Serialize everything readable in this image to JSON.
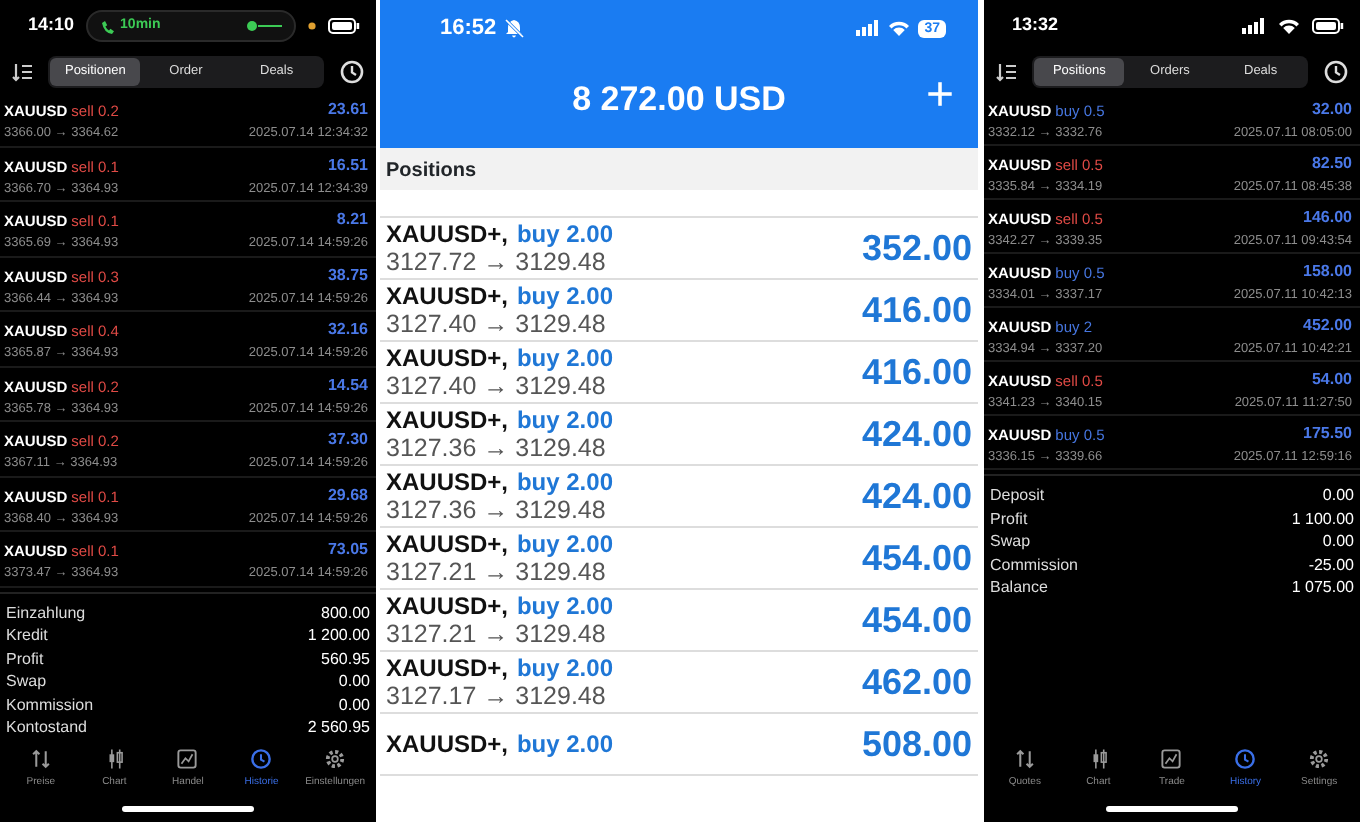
{
  "left_phone": {
    "status_bar": {
      "time": "14:10",
      "call_pill": "10min"
    },
    "segments": [
      {
        "label": "Positionen",
        "selected": true
      },
      {
        "label": "Order",
        "selected": false
      },
      {
        "label": "Deals",
        "selected": false
      }
    ],
    "positions": [
      {
        "symbol": "XAUUSD",
        "kind": "sell",
        "direction": "sell 0.2",
        "prices": "3366.00 → 3364.62",
        "time": "2025.07.14 12:34:32",
        "profit": "23.61"
      },
      {
        "symbol": "XAUUSD",
        "kind": "sell",
        "direction": "sell 0.1",
        "prices": "3366.70 → 3364.93",
        "time": "2025.07.14 12:34:39",
        "profit": "16.51"
      },
      {
        "symbol": "XAUUSD",
        "kind": "sell",
        "direction": "sell 0.1",
        "prices": "3365.69 → 3364.93",
        "time": "2025.07.14 14:59:26",
        "profit": "8.21"
      },
      {
        "symbol": "XAUUSD",
        "kind": "sell",
        "direction": "sell 0.3",
        "prices": "3366.44 → 3364.93",
        "time": "2025.07.14 14:59:26",
        "profit": "38.75"
      },
      {
        "symbol": "XAUUSD",
        "kind": "sell",
        "direction": "sell 0.4",
        "prices": "3365.87 → 3364.93",
        "time": "2025.07.14 14:59:26",
        "profit": "32.16"
      },
      {
        "symbol": "XAUUSD",
        "kind": "sell",
        "direction": "sell 0.2",
        "prices": "3365.78 → 3364.93",
        "time": "2025.07.14 14:59:26",
        "profit": "14.54"
      },
      {
        "symbol": "XAUUSD",
        "kind": "sell",
        "direction": "sell 0.2",
        "prices": "3367.11 → 3364.93",
        "time": "2025.07.14 14:59:26",
        "profit": "37.30"
      },
      {
        "symbol": "XAUUSD",
        "kind": "sell",
        "direction": "sell 0.1",
        "prices": "3368.40 → 3364.93",
        "time": "2025.07.14 14:59:26",
        "profit": "29.68"
      },
      {
        "symbol": "XAUUSD",
        "kind": "sell",
        "direction": "sell 0.1",
        "prices": "3373.47 → 3364.93",
        "time": "2025.07.14 14:59:26",
        "profit": "73.05"
      }
    ],
    "summary": [
      {
        "label": "Einzahlung",
        "value": "800.00"
      },
      {
        "label": "Kredit",
        "value": "1 200.00"
      },
      {
        "label": "Profit",
        "value": "560.95"
      },
      {
        "label": "Swap",
        "value": "0.00"
      },
      {
        "label": "Kommission",
        "value": "0.00"
      },
      {
        "label": "Kontostand",
        "value": "2 560.95"
      }
    ],
    "tab_bar": [
      {
        "label": "Preise",
        "selected": false
      },
      {
        "label": "Chart",
        "selected": false
      },
      {
        "label": "Handel",
        "selected": false
      },
      {
        "label": "Historie",
        "selected": true
      },
      {
        "label": "Einstellungen",
        "selected": false
      }
    ]
  },
  "middle_phone": {
    "status_bar": {
      "time": "16:52",
      "battery": "37"
    },
    "title": "8 272.00 USD",
    "add_button": "+",
    "section": "Positions",
    "positions": [
      {
        "symbol": "XAUUSD+,",
        "direction": "buy 2.00",
        "prices": "3127.72 → 3129.48",
        "profit": "352.00"
      },
      {
        "symbol": "XAUUSD+,",
        "direction": "buy 2.00",
        "prices": "3127.40 → 3129.48",
        "profit": "416.00"
      },
      {
        "symbol": "XAUUSD+,",
        "direction": "buy 2.00",
        "prices": "3127.40 → 3129.48",
        "profit": "416.00"
      },
      {
        "symbol": "XAUUSD+,",
        "direction": "buy 2.00",
        "prices": "3127.36 → 3129.48",
        "profit": "424.00"
      },
      {
        "symbol": "XAUUSD+,",
        "direction": "buy 2.00",
        "prices": "3127.36 → 3129.48",
        "profit": "424.00"
      },
      {
        "symbol": "XAUUSD+,",
        "direction": "buy 2.00",
        "prices": "3127.21 → 3129.48",
        "profit": "454.00"
      },
      {
        "symbol": "XAUUSD+,",
        "direction": "buy 2.00",
        "prices": "3127.21 → 3129.48",
        "profit": "454.00"
      },
      {
        "symbol": "XAUUSD+,",
        "direction": "buy 2.00",
        "prices": "3127.17 → 3129.48",
        "profit": "462.00"
      },
      {
        "symbol": "XAUUSD+,",
        "direction": "buy 2.00",
        "profit": "508.00"
      }
    ]
  },
  "right_phone": {
    "status_bar": {
      "time": "13:32"
    },
    "segments": [
      {
        "label": "Positions",
        "selected": true
      },
      {
        "label": "Orders",
        "selected": false
      },
      {
        "label": "Deals",
        "selected": false
      }
    ],
    "positions": [
      {
        "symbol": "XAUUSD",
        "kind": "buy",
        "direction": "buy 0.5",
        "prices": "3332.12 → 3332.76",
        "time": "2025.07.11 08:05:00",
        "profit": "32.00"
      },
      {
        "symbol": "XAUUSD",
        "kind": "sell",
        "direction": "sell 0.5",
        "prices": "3335.84 → 3334.19",
        "time": "2025.07.11 08:45:38",
        "profit": "82.50"
      },
      {
        "symbol": "XAUUSD",
        "kind": "sell",
        "direction": "sell 0.5",
        "prices": "3342.27 → 3339.35",
        "time": "2025.07.11 09:43:54",
        "profit": "146.00"
      },
      {
        "symbol": "XAUUSD",
        "kind": "buy",
        "direction": "buy 0.5",
        "prices": "3334.01 → 3337.17",
        "time": "2025.07.11 10:42:13",
        "profit": "158.00"
      },
      {
        "symbol": "XAUUSD",
        "kind": "buy",
        "direction": "buy 2",
        "prices": "3334.94 → 3337.20",
        "time": "2025.07.11 10:42:21",
        "profit": "452.00"
      },
      {
        "symbol": "XAUUSD",
        "kind": "sell",
        "direction": "sell 0.5",
        "prices": "3341.23 → 3340.15",
        "time": "2025.07.11 11:27:50",
        "profit": "54.00"
      },
      {
        "symbol": "XAUUSD",
        "kind": "buy",
        "direction": "buy 0.5",
        "prices": "3336.15 → 3339.66",
        "time": "2025.07.11 12:59:16",
        "profit": "175.50"
      }
    ],
    "summary": [
      {
        "label": "Deposit",
        "value": "0.00"
      },
      {
        "label": "Profit",
        "value": "1 100.00"
      },
      {
        "label": "Swap",
        "value": "0.00"
      },
      {
        "label": "Commission",
        "value": "-25.00"
      },
      {
        "label": "Balance",
        "value": "1 075.00"
      }
    ],
    "tab_bar": [
      {
        "label": "Quotes",
        "selected": false
      },
      {
        "label": "Chart",
        "selected": false
      },
      {
        "label": "Trade",
        "selected": false
      },
      {
        "label": "History",
        "selected": true
      },
      {
        "label": "Settings",
        "selected": false
      }
    ]
  }
}
